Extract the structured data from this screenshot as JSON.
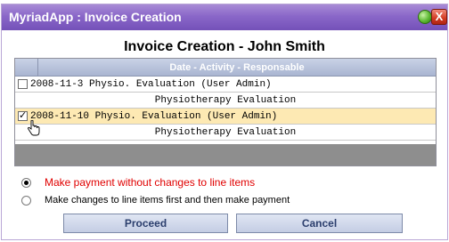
{
  "window": {
    "title": "MyriadApp : Invoice Creation",
    "close_glyph": "X",
    "restore_icon": "green-circle-icon",
    "close_icon": "close-icon"
  },
  "heading": "Invoice Creation - John Smith",
  "grid": {
    "header": "Date - Activity - Responsable",
    "rows": [
      {
        "summary": "2008-11-3 Physio. Evaluation (User Admin)",
        "detail": "Physiotherapy Evaluation",
        "checked": false
      },
      {
        "summary": "2008-11-10 Physio. Evaluation (User Admin)",
        "detail": "Physiotherapy Evaluation",
        "checked": true
      }
    ]
  },
  "options": {
    "option1": "Make payment without changes to line items",
    "option2": "Make changes to line items first and then make payment",
    "selected": "option1"
  },
  "buttons": {
    "proceed": "Proceed",
    "cancel": "Cancel"
  },
  "colors": {
    "title_bar": "#8a67c9",
    "selected_row": "#fde9b3",
    "option1_text": "#e00000"
  }
}
